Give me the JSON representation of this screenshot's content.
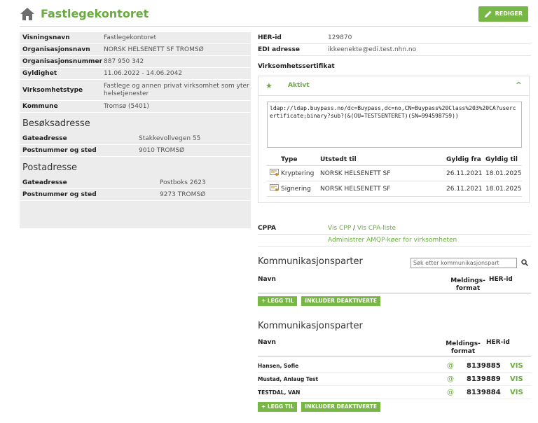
{
  "header": {
    "title": "Fastlegekontoret",
    "edit_label": "REDIGER"
  },
  "details": [
    {
      "label": "Visningsnavn",
      "value": "Fastlegekontoret"
    },
    {
      "label": "Organisasjonsnavn",
      "value": "NORSK HELSENETT SF TROMSØ"
    },
    {
      "label": "Organisasjonsnummer",
      "value": "887 950 342"
    },
    {
      "label": "Gyldighet",
      "value": "11.06.2022 - 14.06.2042"
    },
    {
      "label": "Virksomhetstype",
      "value": "Fastlege og annen privat virksomhet som yter helsetjenester"
    },
    {
      "label": "Kommune",
      "value": "Tromsø (5401)"
    }
  ],
  "besok": {
    "title": "Besøksadresse",
    "rows": [
      {
        "label": "Gateadresse",
        "value": "Stakkevollvegen 55"
      },
      {
        "label": "Postnummer og sted",
        "value": "9010 TROMSØ"
      }
    ]
  },
  "post": {
    "title": "Postadresse",
    "rows": [
      {
        "label": "Gateadresse",
        "value": "Postboks 2623"
      },
      {
        "label": "Postnummer og sted",
        "value": "9273 TROMSØ"
      }
    ]
  },
  "right": {
    "her_label": "HER-id",
    "her_value": "129870",
    "edi_label": "EDI adresse",
    "edi_value": "ikkeenekte@edi.test.nhn.no",
    "cert_title": "Virksomhetssertifikat",
    "cert_status": "Aktivt",
    "ldap": "ldap://ldap.buypass.no/dc=Buypass,dc=no,CN=Buypass%20Class%203%20CA?usercertificate;binary?sub?(&(OU=TESTSENTERET)(SN=994598759))",
    "cert_headers": [
      "Type",
      "Utstedt til",
      "Gyldig fra",
      "Gyldig til"
    ],
    "certs": [
      {
        "type": "Kryptering",
        "to": "NORSK HELSENETT SF",
        "from": "26.11.2021",
        "until": "18.01.2025"
      },
      {
        "type": "Signering",
        "to": "NORSK HELSENETT SF",
        "from": "26.11.2021",
        "until": "18.01.2025"
      }
    ]
  },
  "cppa": {
    "label": "CPPA",
    "link1": "Vis CPP",
    "sep": " / ",
    "link2": "Vis CPA-liste",
    "link3": "Administrer AMQP-køer for virksomheten"
  },
  "kom1": {
    "title": "Kommunikasjonsparter",
    "search_placeholder": "Søk etter kommunikasjonspart",
    "col_name": "Navn",
    "col_format": "Meldings- format",
    "col_her": "HER-id",
    "add_label": "+ LEGG TIL",
    "include_label": "INKLUDER DEAKTIVERTE"
  },
  "kom2": {
    "title": "Kommunikasjonsparter",
    "col_name": "Navn",
    "col_format": "Meldings- format",
    "col_her": "HER-id",
    "rows": [
      {
        "name": "Hansen, Sofie",
        "format": "@",
        "her": "8139885",
        "action": "VIS"
      },
      {
        "name": "Mustad, Anlaug Test",
        "format": "@",
        "her": "8139889",
        "action": "VIS"
      },
      {
        "name": "TESTDAL, VAN",
        "format": "@",
        "her": "8139884",
        "action": "VIS"
      }
    ],
    "add_label": "+ LEGG TIL",
    "include_label": "INKLUDER DEAKTIVERTE"
  },
  "colors": {
    "accent": "#6aab3f",
    "button": "#76b843"
  }
}
